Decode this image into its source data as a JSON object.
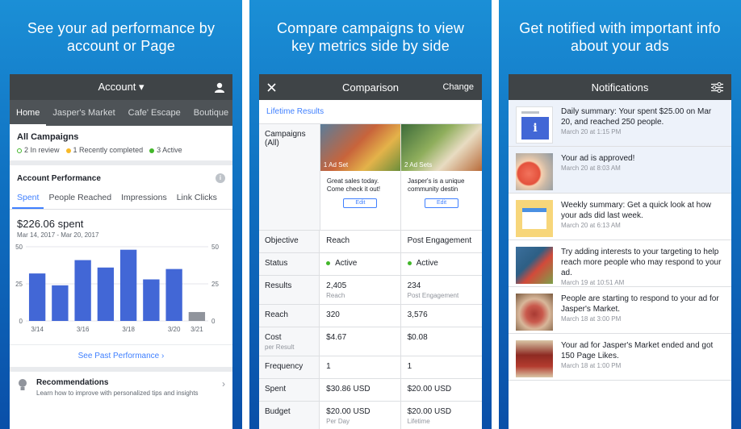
{
  "panel1": {
    "headline": [
      "See your ad performance by",
      "account or Page"
    ],
    "nav_title": "Account ▾",
    "tabs": [
      "Home",
      "Jasper's Market",
      "Cafe' Escape",
      "Boutique"
    ],
    "all_campaigns": "All Campaigns",
    "legend": [
      {
        "label": "2 In review",
        "color": "#ffffff"
      },
      {
        "label": "1 Recently completed",
        "color": "#f7b928"
      },
      {
        "label": "3 Active",
        "color": "#42b72a"
      }
    ],
    "account_performance": "Account Performance",
    "metric_tabs": [
      "Spent",
      "People Reached",
      "Impressions",
      "Link Clicks"
    ],
    "spent_value": "$226.06 spent",
    "spent_range": "Mar 14, 2017 - Mar 20, 2017",
    "see_past": "See Past Performance  ›",
    "rec_title": "Recommendations",
    "rec_sub": "Learn how to improve with personalized tips and insights"
  },
  "chart_data": {
    "type": "bar",
    "x_tick_labels": [
      "3/14",
      "3/16",
      "3/18",
      "3/20",
      "3/21"
    ],
    "values": [
      32,
      24,
      41,
      36,
      48,
      28,
      35,
      6
    ],
    "ylim": [
      0,
      50
    ],
    "y_ticks": [
      "50",
      "25",
      "0"
    ],
    "colors": {
      "bar": "#4267d6",
      "last_bar": "#90949c"
    }
  },
  "panel2": {
    "headline": [
      "Compare campaigns to view",
      "key metrics side by side"
    ],
    "nav_title": "Comparison",
    "nav_right": "Change",
    "lifetime": "Lifetime Results",
    "campaigns_label": "Campaigns (All)",
    "cards": [
      {
        "adset": "1 Ad Set",
        "text": "Great sales today. Come check it out!",
        "edit": "Edit"
      },
      {
        "adset": "2 Ad Sets",
        "text": "Jasper's is a unique community destin",
        "edit": "Edit"
      }
    ],
    "rows": [
      {
        "label": "Objective",
        "label_sub": "",
        "a": "Reach",
        "a_sub": "",
        "b": "Post Engagement",
        "b_sub": ""
      },
      {
        "label": "Status",
        "label_sub": "",
        "a": "Active",
        "a_sub": "",
        "b": "Active",
        "b_sub": ""
      },
      {
        "label": "Results",
        "label_sub": "",
        "a": "2,405",
        "a_sub": "Reach",
        "b": "234",
        "b_sub": "Post Engagement"
      },
      {
        "label": "Reach",
        "label_sub": "",
        "a": "320",
        "a_sub": "",
        "b": "3,576",
        "b_sub": ""
      },
      {
        "label": "Cost",
        "label_sub": "per Result",
        "a": "$4.67",
        "a_sub": "",
        "b": "$0.08",
        "b_sub": ""
      },
      {
        "label": "Frequency",
        "label_sub": "",
        "a": "1",
        "a_sub": "",
        "b": "1",
        "b_sub": ""
      },
      {
        "label": "Spent",
        "label_sub": "",
        "a": "$30.86 USD",
        "a_sub": "",
        "b": "$20.00 USD",
        "b_sub": ""
      },
      {
        "label": "Budget",
        "label_sub": "",
        "a": "$20.00 USD",
        "a_sub": "Per Day",
        "b": "$20.00 USD",
        "b_sub": "Lifetime"
      }
    ]
  },
  "panel3": {
    "headline": [
      "Get notified with important info",
      "about your ads"
    ],
    "nav_title": "Notifications",
    "items": [
      {
        "text": "Daily summary: Your spent $25.00 on Mar 20, and reached 250 people.",
        "time": "March 20 at 1:15 PM",
        "icon": "info-icon"
      },
      {
        "text": "Your ad is approved!",
        "time": "March 20 at 8:03 AM",
        "icon": "grapefruit-image"
      },
      {
        "text": "Weekly summary: Get a quick look at how your ads did last week.",
        "time": "March 20 at 6:13 AM",
        "icon": "calendar-icon"
      },
      {
        "text": "Try adding interests to your targeting to help reach more people who may respond to your ad.",
        "time": "March 19 at 10:51 AM",
        "icon": "produce-image"
      },
      {
        "text": "People are starting to respond to your ad for Jasper's Market.",
        "time": "March 18 at 3:00 PM",
        "icon": "meat-image"
      },
      {
        "text": "Your ad for Jasper's Market ended and got 150 Page Likes.",
        "time": "March 18 at 1:00 PM",
        "icon": "jam-jar-image"
      }
    ]
  }
}
